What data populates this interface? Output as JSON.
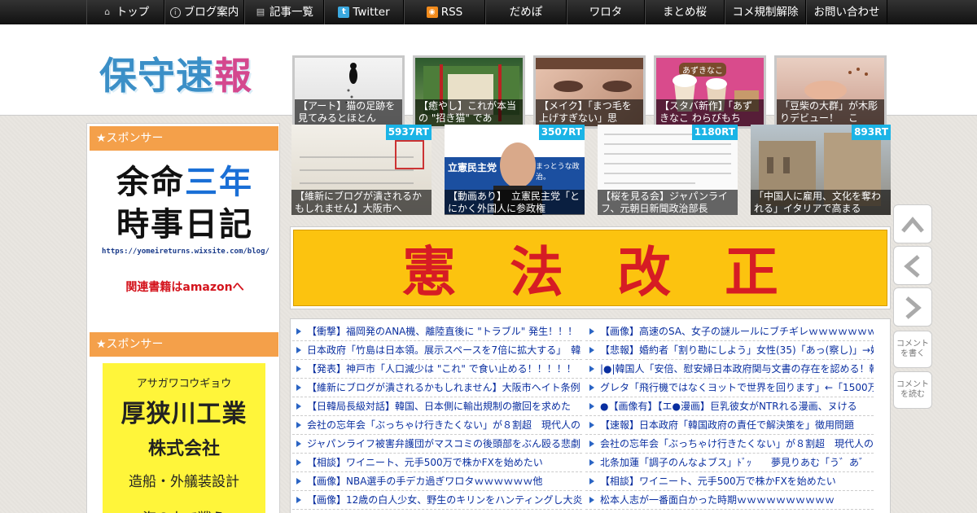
{
  "nav": [
    {
      "label": "トップ",
      "icon": "home-icon"
    },
    {
      "label": "ブログ案内",
      "icon": "info-icon"
    },
    {
      "label": "記事一覧",
      "icon": "list-icon"
    },
    {
      "label": "Twitter",
      "icon": "twitter-icon"
    },
    {
      "label": "RSS",
      "icon": "rss-icon"
    },
    {
      "label": "だめぽ"
    },
    {
      "label": "ワロタ"
    },
    {
      "label": "まとめ桜"
    },
    {
      "label": "コメ規制解除"
    },
    {
      "label": "お問い合わせ"
    }
  ],
  "logo": {
    "c1": "保",
    "c2": "守",
    "c3": "速",
    "c4": "報"
  },
  "header_thumbs": [
    {
      "caption": "【アート】猫の足跡を見てみるとほとん"
    },
    {
      "caption": "【癒やし】これが本当の \"招き猫\" であ"
    },
    {
      "caption": "【メイク】「まつ毛を上げすぎない」思"
    },
    {
      "caption": "【スタバ新作】「あずきなこ わらびもち"
    },
    {
      "caption": "「豆柴の大群」が木彫りデビュー！　こ"
    }
  ],
  "header_thumb_texts": {
    "sweets_label": "あずきなこ"
  },
  "sidebar": {
    "sponsor1": "★スポンサー",
    "sponsor2": "★スポンサー",
    "ad1": {
      "l1a": "余命",
      "l1b": "三年",
      "l2": "時事日記",
      "url": "https://yomeireturns.wixsite.com/blog/",
      "amazon": "関連書籍はamazonへ"
    },
    "ad2": {
      "kana": "アサガワコウギョウ",
      "name": "厚狭川工業",
      "kk": "株式会社",
      "biz": "造船・外艤装設計",
      "sea": "海の上で戦う"
    }
  },
  "rt_items": [
    {
      "count": "5937RT",
      "caption": "【維新にブログが潰されるかもしれません】大阪市へ"
    },
    {
      "count": "3507RT",
      "caption": "【動画あり】　立憲民主党「とにかく外国人に参政権"
    },
    {
      "count": "1180RT",
      "caption": "【桜を見る会】ジャパンライフ、元朝日新聞政治部長"
    },
    {
      "count": "893RT",
      "caption": "「中国人に雇用、文化を奪われる」イタリアで高まる"
    }
  ],
  "rt_texts": {
    "party": "立憲民主党",
    "slogan": "まっとうな政治。"
  },
  "banner": {
    "c1": "憲",
    "c2": "法",
    "c3": "改",
    "c4": "正"
  },
  "side_buttons": {
    "comment_write": "コメントを書く",
    "comment_read": "コメントを読む"
  },
  "links_left": [
    "【衝撃】福岡発のANA機、離陸直後に \"トラブル\" 発生！！！",
    "日本政府「竹島は日本領。展示スペースを7倍に拡大する」　韓",
    "【発表】神戸市「人口減少は \"これ\" で食い止める！！！！！",
    "【維新にブログが潰されるかもしれません】大阪市ヘイト条例",
    "【日韓局長級対話】韓国、日本側に輸出規制の撤回を求めた",
    "会社の忘年会「ぶっちゃけ行きたくない」が８割超　現代人の",
    "ジャパンライフ被害弁護団がマスコミの後頭部をぶん殴る悲劇",
    "【相談】ワイニート、元手500万で株かFXを始めたい",
    "【画像】NBA選手の手デカ過ぎワロタｗｗｗｗｗｗ他",
    "【画像】12歳の白人少女、野生のキリンをハンティングし大炎"
  ],
  "links_right": [
    "【画像】高速のSA、女子の謎ルールにブチギレｗｗｗｗｗｗｗ",
    "【悲報】婚約者「割り勘にしよう」女性(35)「あっ(察し)」→婚",
    "|●|韓国人「安倍、慰安婦日本政府関与文書の存在を認める！韓",
    "グレタ「飛行機ではなくヨットで世界を回ります」←「1500万",
    "●【画像有】【エ●漫画】巨乳彼女がNTRれる漫画、ヌける",
    "【速報】日本政府「韓国政府の責任で解決策を」徴用問題",
    "会社の忘年会「ぶっちゃけ行きたくない」が８割超　現代人の",
    "北条加蓮「調子のんなよブス」ﾄﾞｯ　　夢見りあむ「う゛あ゛",
    "【相談】ワイニート、元手500万で株かFXを始めたい",
    "松本人志が一番面白かった時期ｗｗｗｗｗｗｗｗｗｗ"
  ],
  "colors": {
    "nav_bg": "#1a1a1a",
    "sponsor_orange": "#f4a04a",
    "rt_badge": "#1bb4e6",
    "link_blue": "#0a2fa0",
    "banner_yellow": "#fcc30f",
    "banner_red": "#d61c24"
  }
}
